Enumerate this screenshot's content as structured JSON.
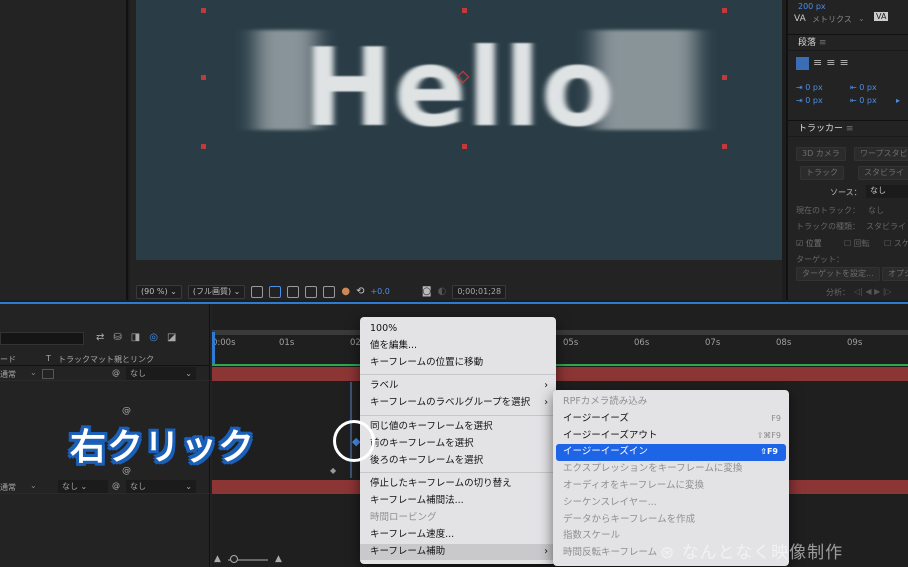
{
  "colors": {
    "accent": "#2d7bd4",
    "menu_bg": "#e3e3e6",
    "menu_selected": "#1e64e6",
    "track_red": "#8c3535",
    "canvas": "#2a3d47"
  },
  "composition": {
    "hello_text": "Hello",
    "zoom": "(90 %)",
    "resolution": "(フル画質)",
    "exposure": "+0.0",
    "timecode": "0;00;01;28"
  },
  "character_panel": {
    "leading": "200 px",
    "kerning_label": "メトリクス",
    "tsume": "VA"
  },
  "paragraph_panel": {
    "title": "段落",
    "indents": [
      "0 px",
      "0 px",
      "0 px",
      "0 px",
      "0 px"
    ]
  },
  "tracker_panel": {
    "title": "トラッカー",
    "btn_3d_camera": "3D カメラ",
    "btn_warp": "ワープスタビ",
    "btn_track": "トラック",
    "btn_stabilize": "スタビライ",
    "source_label": "ソース：",
    "source_value": "なし",
    "current_track_label": "現在のトラック：",
    "current_track_value": "なし",
    "track_type_label": "トラックの種類：",
    "track_type_value": "スタビライ",
    "opt_position": "位置",
    "opt_rotation": "回転",
    "opt_scale": "スケール",
    "btn_target_label": "ターゲット：",
    "btn_target_set": "ターゲットを設定...",
    "btn_options": "オプシ",
    "analyze_label": "分析："
  },
  "timeline": {
    "col_mode": "ード",
    "col_t": "T",
    "col_trackmatte": "トラックマット",
    "col_parent": "親とリンク",
    "ruler": [
      "0:00s",
      "01s",
      "02s",
      "03s",
      "04s",
      "05s",
      "06s",
      "07s",
      "08s",
      "09s"
    ],
    "layer1": {
      "mode": "通常",
      "parent": "なし"
    },
    "layer2": {
      "mode": "通常",
      "matte": "なし",
      "parent": "なし"
    }
  },
  "context_menu": {
    "items": [
      {
        "label": "100%"
      },
      {
        "label": "値を編集..."
      },
      {
        "label": "キーフレームの位置に移動"
      },
      {
        "sep": true
      },
      {
        "label": "ラベル",
        "submenu": true
      },
      {
        "label": "キーフレームのラベルグループを選択",
        "submenu": true
      },
      {
        "sep": true
      },
      {
        "label": "同じ値のキーフレームを選択"
      },
      {
        "label": "前のキーフレームを選択"
      },
      {
        "label": "後ろのキーフレームを選択"
      },
      {
        "sep": true
      },
      {
        "label": "停止したキーフレームの切り替え"
      },
      {
        "label": "キーフレーム補間法..."
      },
      {
        "label": "時間ロービング",
        "disabled": true
      },
      {
        "label": "キーフレーム速度..."
      },
      {
        "label": "キーフレーム補助",
        "submenu": true,
        "hover": true
      }
    ]
  },
  "submenu": {
    "items": [
      {
        "label": "RPFカメラ読み込み",
        "disabled": true
      },
      {
        "label": "イージーイーズ",
        "shortcut": "F9"
      },
      {
        "label": "イージーイーズアウト",
        "shortcut": "⇧⌘F9"
      },
      {
        "label": "イージーイーズイン",
        "shortcut": "⇧F9",
        "selected": true
      },
      {
        "label": "エクスプレッションをキーフレームに変換",
        "disabled": true
      },
      {
        "label": "オーディオをキーフレームに変換",
        "disabled": true
      },
      {
        "label": "シーケンスレイヤー...",
        "disabled": true
      },
      {
        "label": "データからキーフレームを作成",
        "disabled": true
      },
      {
        "label": "指数スケール",
        "disabled": true
      },
      {
        "label": "時間反転キーフレーム",
        "disabled": true
      }
    ]
  },
  "annotation": {
    "right_click": "右クリック"
  },
  "watermark": "なんとなく映像制作"
}
